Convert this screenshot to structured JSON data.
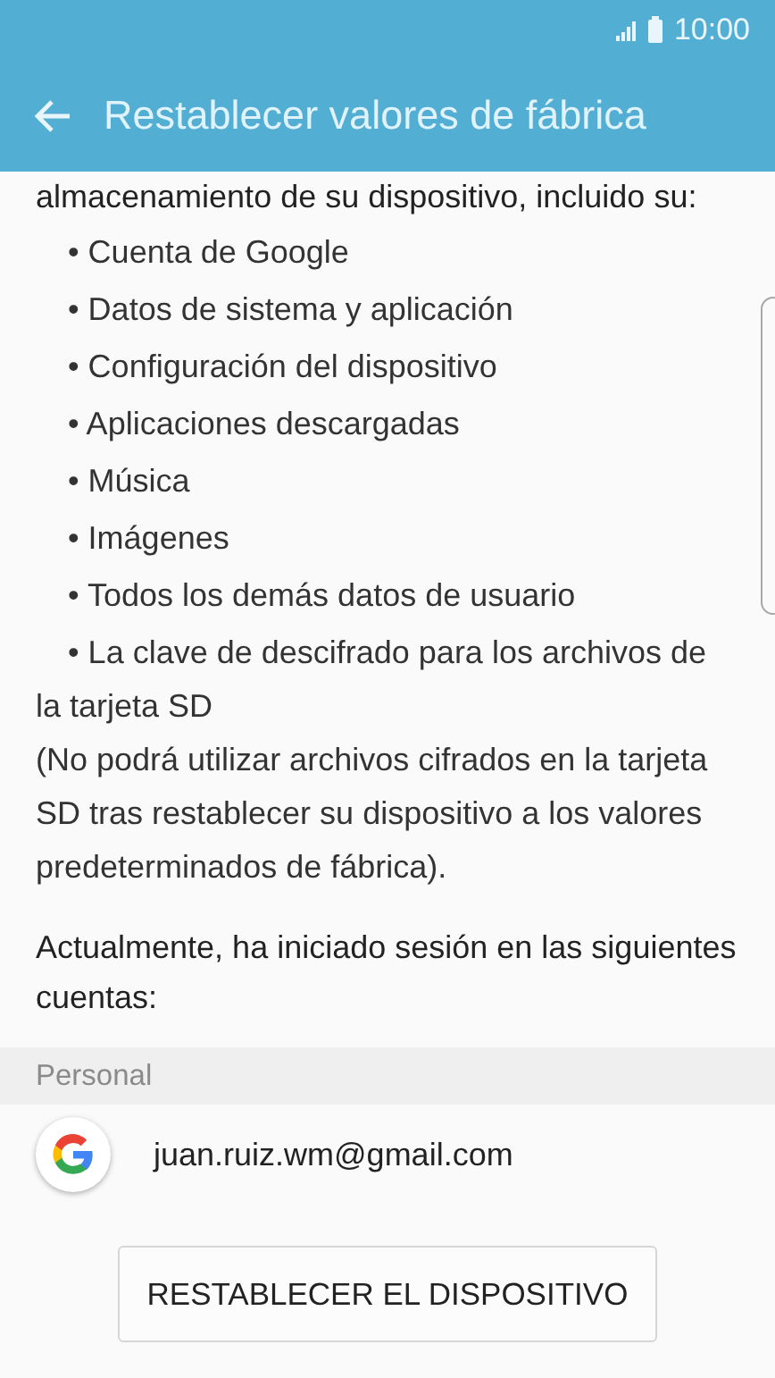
{
  "status_bar": {
    "time": "10:00"
  },
  "app_bar": {
    "title": "Restablecer valores de fábrica"
  },
  "intro": "almacenamiento de su dispositivo, incluido su:",
  "items": [
    "• Cuenta de Google",
    "• Datos de sistema y aplicación",
    "• Configuración del dispositivo",
    "• Aplicaciones descargadas",
    "• Música",
    "• Imágenes",
    "• Todos los demás datos de usuario",
    "• La clave de descifrado para los archivos de la tarjeta SD"
  ],
  "note": "(No podrá utilizar archivos cifrados en la tarjeta SD tras restablecer su dispositivo a los valores predeterminados de fábrica).",
  "accounts_text": "Actualmente, ha iniciado sesión en las siguientes cuentas:",
  "section": {
    "header": "Personal",
    "accounts": [
      {
        "email": "juan.ruiz.wm@gmail.com"
      }
    ]
  },
  "button": "RESTABLECER EL DISPOSITIVO"
}
